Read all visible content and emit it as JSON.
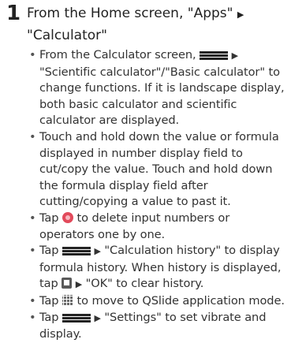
{
  "step": {
    "number": "1",
    "heading_part1": "From the Home screen, \"Apps\" ",
    "arrow": "▶",
    "heading_part2": " \"Calculator\""
  },
  "icons": {
    "menu": "menu-icon",
    "delete": "delete-icon",
    "trash": "trash-icon",
    "qslide": "qslide-icon"
  },
  "notes": {
    "n1_a": "From the Calculator screen, ",
    "n1_arrow": "▶",
    "n1_b": " \"Scientific calculator\"/\"Basic calculator\" to change functions. If it is landscape display, both basic calculator and scientific calculator are displayed.",
    "n2": "Touch and hold down the value or formula displayed in number display field to cut/copy the value. Touch and hold down the formula display field after cutting/copying a value to past it.",
    "n3_a": "Tap ",
    "n3_b": " to delete input numbers or operators one by one.",
    "n4_a": "Tap ",
    "n4_arrow1": "▶",
    "n4_b": " \"Calculation history\" to display formula history. When history is displayed, tap ",
    "n4_arrow2": "▶",
    "n4_c": " \"OK\" to clear history.",
    "n5_a": "Tap ",
    "n5_b": " to move to QSlide application mode.",
    "n6_a": "Tap ",
    "n6_arrow": "▶",
    "n6_b": " \"Settings\" to set vibrate and display."
  }
}
